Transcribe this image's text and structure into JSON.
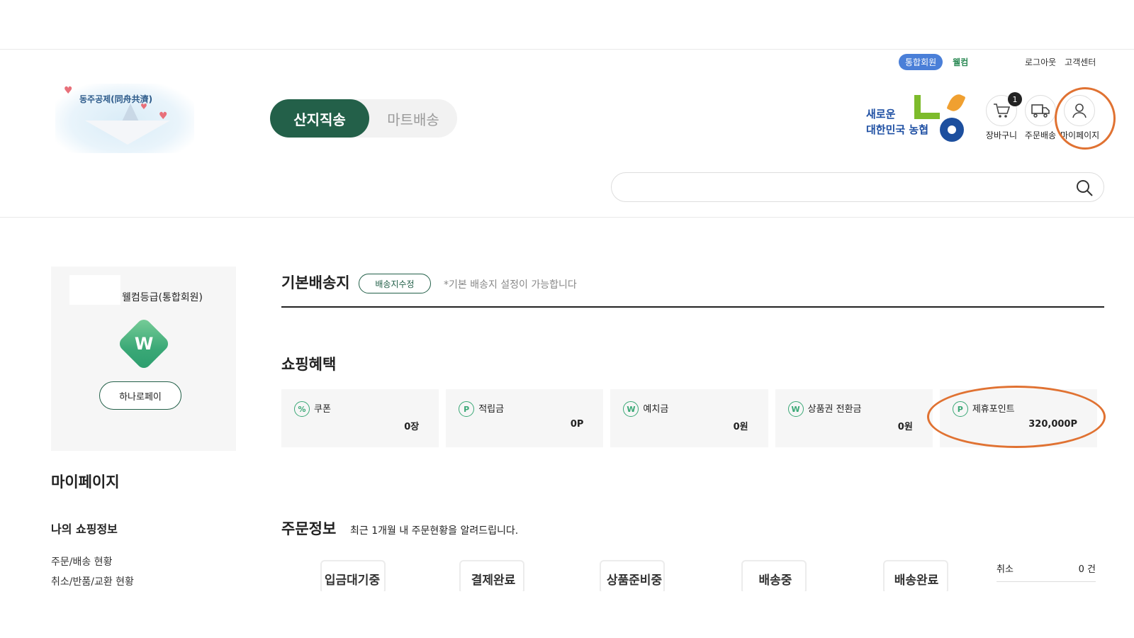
{
  "header": {
    "member_badge": "통합회원",
    "welcome": "웰컴",
    "logout": "로그아웃",
    "customer_center": "고객센터",
    "logo_title": "동주공제(同舟共濟)",
    "tabs": [
      {
        "label": "산지직송",
        "active": true
      },
      {
        "label": "마트배송",
        "active": false
      }
    ],
    "brand_line1": "새로운",
    "brand_line2": "대한민국 농협",
    "cart_label": "장바구니",
    "cart_count": "1",
    "order_label": "주문배송",
    "mypage_label": "마이페이지",
    "search_placeholder": "",
    "icons": {
      "cart": "cart-icon",
      "truck": "truck-icon",
      "user": "user-icon",
      "search": "search-icon"
    }
  },
  "sidebar": {
    "grade": "웰컴등급(통합회원)",
    "grade_letter": "W",
    "pay_button": "하나로페이",
    "title": "마이페이지",
    "subtitle": "나의 쇼핑정보",
    "links": [
      "주문/배송 현황",
      "취소/반품/교환 현황"
    ]
  },
  "main": {
    "address": {
      "title": "기본배송지",
      "edit_button": "배송지수정",
      "note": "*기본 배송지 설정이 가능합니다"
    },
    "benefits": {
      "title": "쇼핑혜택",
      "items": [
        {
          "icon": "%",
          "label": "쿠폰",
          "value": "0장"
        },
        {
          "icon": "P",
          "label": "적립금",
          "value": "0P"
        },
        {
          "icon": "W",
          "label": "예치금",
          "value": "0원"
        },
        {
          "icon": "W",
          "label": "상품권 전환금",
          "value": "0원"
        },
        {
          "icon": "P",
          "label": "제휴포인트",
          "value": "320,000P"
        }
      ]
    },
    "orders": {
      "title": "주문정보",
      "note": "최근 1개월 내 주문현황을 알려드립니다.",
      "statuses": [
        "입금대기중",
        "결제완료",
        "상품준비중",
        "배송중",
        "배송완료"
      ],
      "cancel_label": "취소",
      "cancel_value": "0 건"
    }
  },
  "colors": {
    "brand_green": "#236049",
    "accent_green": "#3aa876",
    "badge_blue": "#4a7fd8",
    "annotation_orange": "#e07232"
  }
}
